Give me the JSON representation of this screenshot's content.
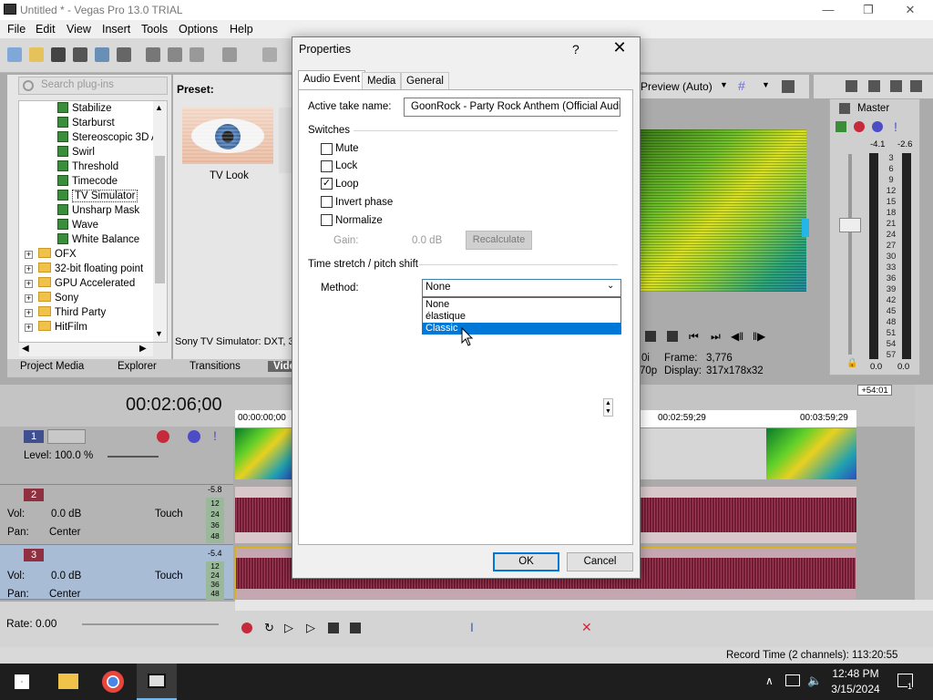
{
  "app": {
    "title": "Untitled * - Vegas Pro 13.0 TRIAL",
    "window_controls": {
      "minimize": "—",
      "maximize": "❐",
      "close": "✕"
    }
  },
  "menu": [
    "File",
    "Edit",
    "View",
    "Insert",
    "Tools",
    "Options",
    "Help"
  ],
  "plugins": {
    "search_placeholder": "Search plug-ins",
    "preset_label": "Preset:",
    "preset_name": "TV Look",
    "status": "Sony TV Simulator: DXT, 3...",
    "items": [
      {
        "label": "Stabilize",
        "type": "fx"
      },
      {
        "label": "Starburst",
        "type": "fx"
      },
      {
        "label": "Stereoscopic 3D A",
        "type": "fx"
      },
      {
        "label": "Swirl",
        "type": "fx"
      },
      {
        "label": "Threshold",
        "type": "fx"
      },
      {
        "label": "Timecode",
        "type": "fx"
      },
      {
        "label": "TV Simulator",
        "type": "fx",
        "selected": true
      },
      {
        "label": "Unsharp Mask",
        "type": "fx"
      },
      {
        "label": "Wave",
        "type": "fx"
      },
      {
        "label": "White Balance",
        "type": "fx"
      },
      {
        "label": "OFX",
        "type": "folder"
      },
      {
        "label": "32-bit floating point",
        "type": "folder"
      },
      {
        "label": "GPU Accelerated",
        "type": "folder"
      },
      {
        "label": "Sony",
        "type": "folder"
      },
      {
        "label": "Third Party",
        "type": "folder"
      },
      {
        "label": "HitFilm",
        "type": "folder"
      }
    ]
  },
  "tabs": [
    "Project Media",
    "Explorer",
    "Transitions",
    "Video"
  ],
  "preview": {
    "mode": "Preview (Auto)",
    "frame_label": "Frame:",
    "frame_value": "3,776",
    "display_label": "Display:",
    "display_value": "317x178x32",
    "res_fragment": "70p",
    "frame_fragment": "0i"
  },
  "master": {
    "title": "Master",
    "peak_left": "-4.1",
    "peak_right": "-2.6",
    "scale": [
      "3",
      "6",
      "9",
      "12",
      "15",
      "18",
      "21",
      "24",
      "27",
      "30",
      "33",
      "36",
      "39",
      "42",
      "45",
      "48",
      "51",
      "54",
      "57"
    ],
    "bottom_left": "0.0",
    "bottom_right": "0.0"
  },
  "timeline": {
    "timecode": "00:02:06;00",
    "offset_badge": "+54:01",
    "ruler": [
      "00:00:00;00",
      "00:02:59;29",
      "00:03:59;29"
    ]
  },
  "tracks": [
    {
      "num": "1",
      "type": "video",
      "level_label": "Level:",
      "level_value": "100.0 %"
    },
    {
      "num": "2",
      "type": "audio",
      "vol_label": "Vol:",
      "vol_value": "0.0 dB",
      "pan_label": "Pan:",
      "pan_value": "Center",
      "mode": "Touch",
      "peak": "-5.8",
      "scale": [
        "12",
        "24",
        "36",
        "48"
      ]
    },
    {
      "num": "3",
      "type": "audio",
      "vol_label": "Vol:",
      "vol_value": "0.0 dB",
      "pan_label": "Pan:",
      "pan_value": "Center",
      "mode": "Touch",
      "peak": "-5.4",
      "scale": [
        "12",
        "24",
        "36",
        "48"
      ],
      "selected": true
    }
  ],
  "bottom": {
    "rate": "Rate: 0.00",
    "record_time": "Record Time (2 channels): 113:20:55"
  },
  "taskbar": {
    "time": "12:48 PM",
    "date": "3/15/2024",
    "notification_count": "1"
  },
  "dialog": {
    "title": "Properties",
    "help": "?",
    "close": "✕",
    "tabs": [
      "Audio Event",
      "Media",
      "General"
    ],
    "active_take_label": "Active take name:",
    "active_take_value": "GoonRock - Party Rock Anthem (Official Audio)",
    "switches_label": "Switches",
    "switches": [
      {
        "label": "Mute",
        "checked": false
      },
      {
        "label": "Lock",
        "checked": false
      },
      {
        "label": "Loop",
        "checked": true
      },
      {
        "label": "Invert phase",
        "checked": false
      },
      {
        "label": "Normalize",
        "checked": false
      }
    ],
    "gain_label": "Gain:",
    "gain_value": "0.0 dB",
    "recalculate": "Recalculate",
    "stretch_label": "Time stretch / pitch shift",
    "method_label": "Method:",
    "method_value": "None",
    "method_options": [
      "None",
      "élastique",
      "Classic"
    ],
    "method_highlighted": "Classic",
    "ok": "OK",
    "cancel": "Cancel"
  }
}
